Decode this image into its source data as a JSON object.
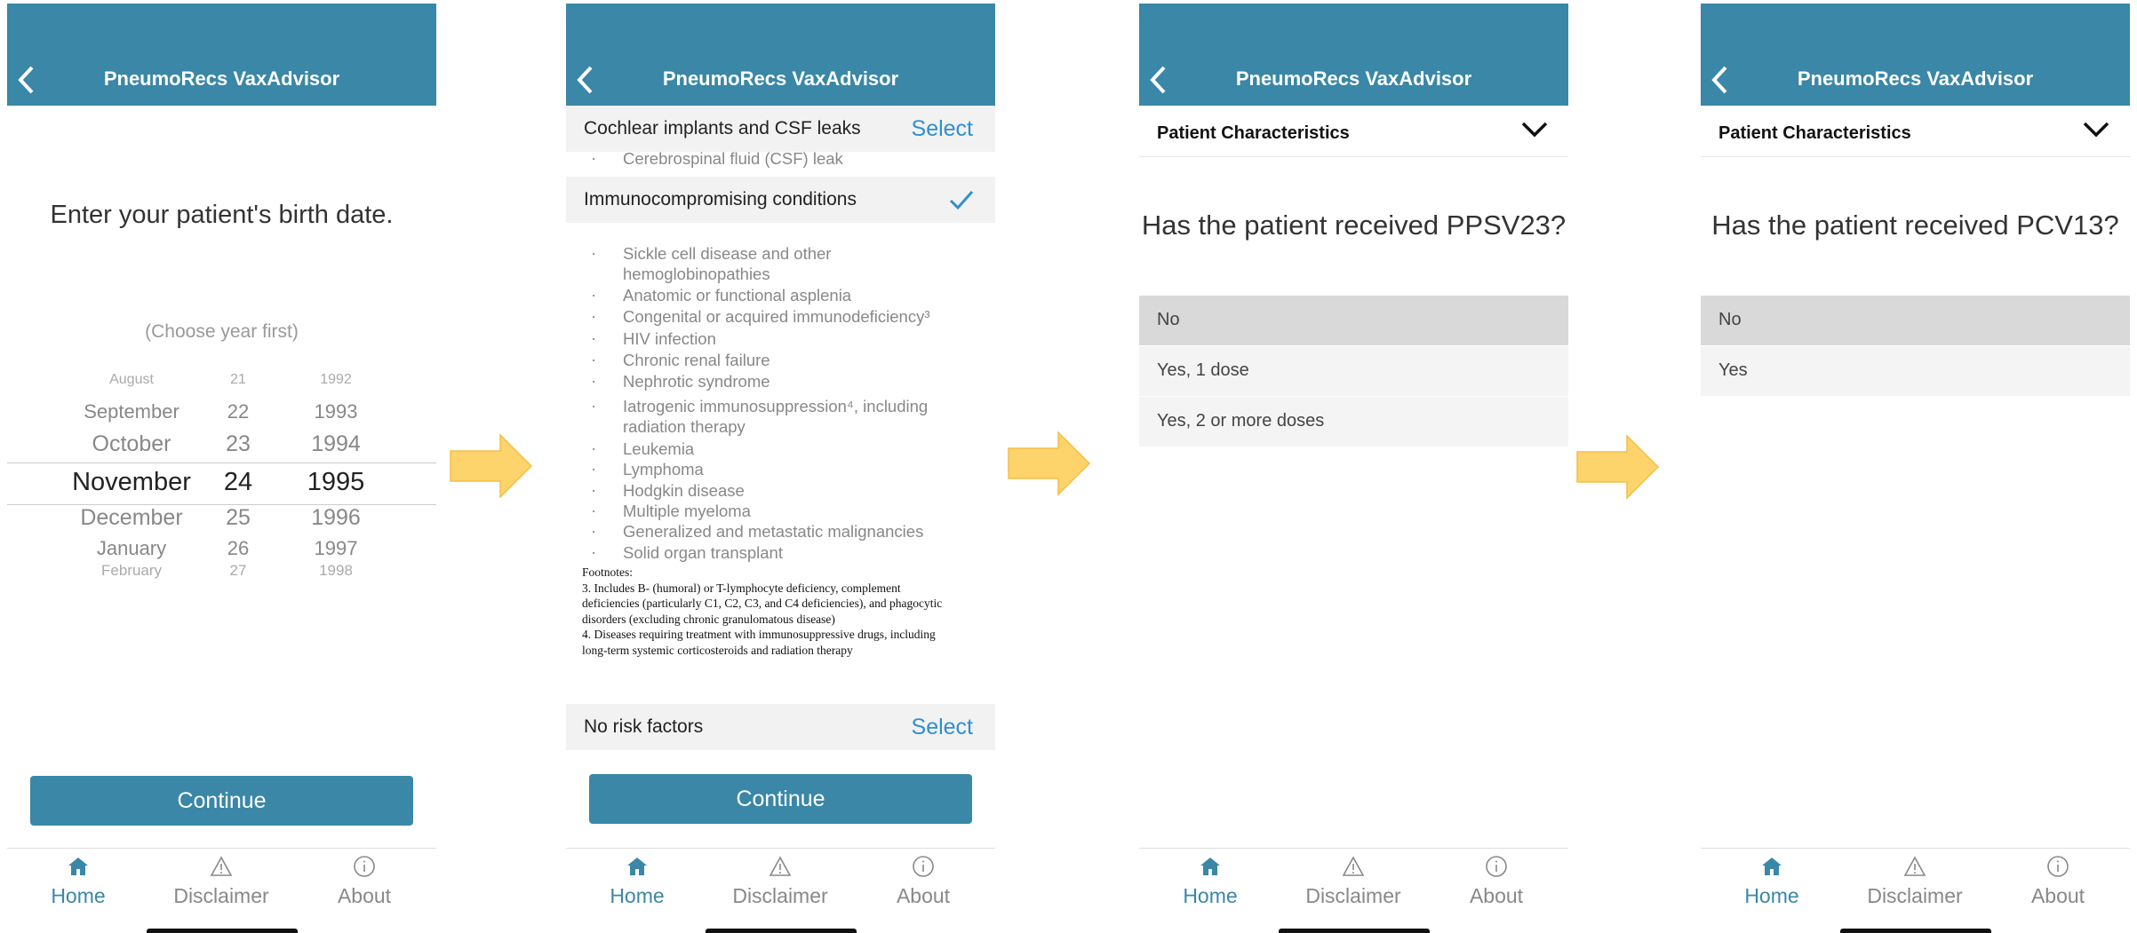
{
  "app_title": "PneumoRecs VaxAdvisor",
  "tabs": {
    "home": "Home",
    "disclaimer": "Disclaimer",
    "about": "About"
  },
  "continue_label": "Continue",
  "colors": {
    "header": "#3a87a7",
    "accent": "#2f8fd1",
    "arrow": "#fdd36b"
  },
  "screen1": {
    "prompt": "Enter your patient's birth date.",
    "hint": "(Choose year first)",
    "picker_rows": [
      {
        "month": "August",
        "day": "21",
        "year": "1992"
      },
      {
        "month": "September",
        "day": "22",
        "year": "1993"
      },
      {
        "month": "October",
        "day": "23",
        "year": "1994"
      },
      {
        "month": "November",
        "day": "24",
        "year": "1995"
      },
      {
        "month": "December",
        "day": "25",
        "year": "1996"
      },
      {
        "month": "January",
        "day": "26",
        "year": "1997"
      },
      {
        "month": "February",
        "day": "27",
        "year": "1998"
      }
    ]
  },
  "screen2": {
    "section_cochlear": {
      "title": "Cochlear implants and CSF leaks",
      "action": "Select"
    },
    "cochlear_item": "Cerebrospinal fluid (CSF) leak",
    "section_immuno": {
      "title": "Immunocompromising conditions"
    },
    "immuno_items": [
      "Sickle cell disease and other hemoglobinopathies",
      "Anatomic or functional asplenia",
      "Congenital or acquired immunodeficiency³",
      "HIV infection",
      "Chronic renal failure",
      "Nephrotic syndrome",
      "Iatrogenic immunosuppression⁴, including radiation therapy",
      "Leukemia",
      "Lymphoma",
      "Hodgkin disease",
      "Multiple myeloma",
      "Generalized and metastatic malignancies",
      "Solid organ transplant"
    ],
    "footnotes": [
      "Footnotes:",
      "3. Includes B- (humoral) or T-lymphocyte deficiency, complement deficiencies (particularly C1, C2, C3, and C4 deficiencies), and phagocytic disorders (excluding chronic granulomatous disease)",
      "4. Diseases requiring treatment with immunosuppressive drugs, including long-term systemic corticosteroids and radiation therapy"
    ],
    "section_norisk": {
      "title": "No risk factors",
      "action": "Select"
    }
  },
  "screen3": {
    "bar_title": "Patient Characteristics",
    "question": "Has the patient received PPSV23?",
    "options": [
      "No",
      "Yes, 1 dose",
      "Yes, 2 or more doses"
    ]
  },
  "screen4": {
    "bar_title": "Patient Characteristics",
    "question": "Has the patient received PCV13?",
    "options": [
      "No",
      "Yes"
    ]
  }
}
